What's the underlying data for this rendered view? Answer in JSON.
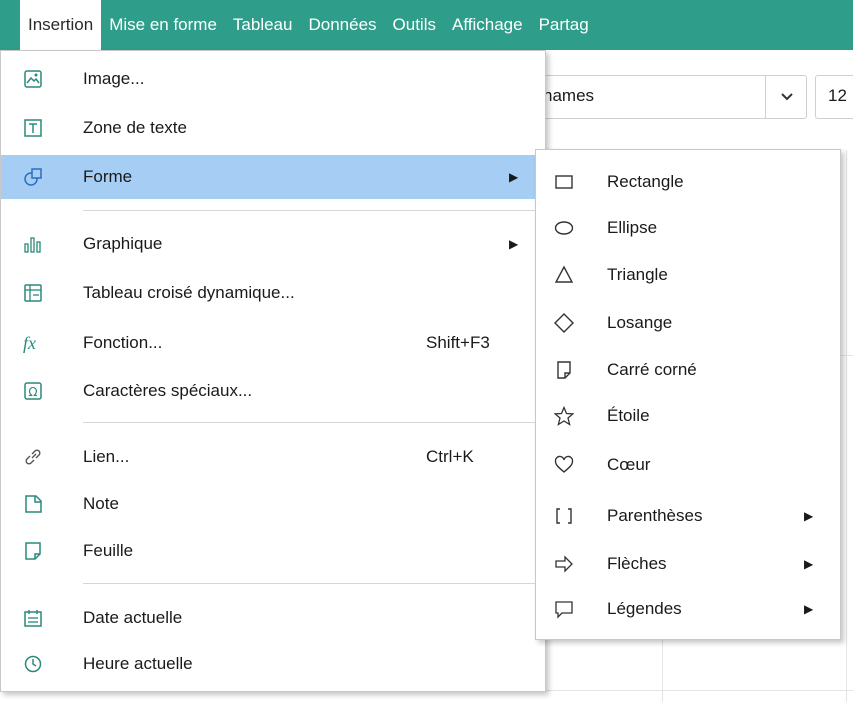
{
  "menubar": {
    "items": [
      "Insertion",
      "Mise en forme",
      "Tableau",
      "Données",
      "Outils",
      "Affichage",
      "Partag"
    ],
    "active_index": 0,
    "bg_color": "#2e9e8a"
  },
  "toolbar": {
    "font_name": "hames",
    "font_size": "12"
  },
  "menu": {
    "highlight_color": "#a6cdf4",
    "items": [
      {
        "label": "Image...",
        "icon": "image-icon"
      },
      {
        "label": "Zone de texte",
        "icon": "text-box-icon"
      },
      {
        "label": "Forme",
        "icon": "shapes-icon",
        "submenu": true,
        "highlighted": true
      },
      {
        "label": "Graphique",
        "icon": "chart-icon",
        "submenu": true
      },
      {
        "label": "Tableau croisé dynamique...",
        "icon": "pivot-table-icon"
      },
      {
        "label": "Fonction...",
        "icon": "function-icon",
        "shortcut": "Shift+F3"
      },
      {
        "label": "Caractères spéciaux...",
        "icon": "omega-icon"
      },
      {
        "label": "Lien...",
        "icon": "link-icon",
        "shortcut": "Ctrl+K"
      },
      {
        "label": "Note",
        "icon": "note-icon"
      },
      {
        "label": "Feuille",
        "icon": "sheet-icon"
      },
      {
        "label": "Date actuelle",
        "icon": "calendar-icon"
      },
      {
        "label": "Heure actuelle",
        "icon": "clock-icon"
      }
    ]
  },
  "submenu": {
    "items": [
      {
        "label": "Rectangle",
        "icon": "rectangle-icon"
      },
      {
        "label": "Ellipse",
        "icon": "ellipse-icon"
      },
      {
        "label": "Triangle",
        "icon": "triangle-icon"
      },
      {
        "label": "Losange",
        "icon": "diamond-icon"
      },
      {
        "label": "Carré corné",
        "icon": "folded-corner-icon"
      },
      {
        "label": "Étoile",
        "icon": "star-icon"
      },
      {
        "label": "Cœur",
        "icon": "heart-icon"
      },
      {
        "label": "Parenthèses",
        "icon": "brackets-icon",
        "submenu": true
      },
      {
        "label": "Flèches",
        "icon": "arrow-icon",
        "submenu": true
      },
      {
        "label": "Légendes",
        "icon": "callout-icon",
        "submenu": true
      }
    ]
  }
}
